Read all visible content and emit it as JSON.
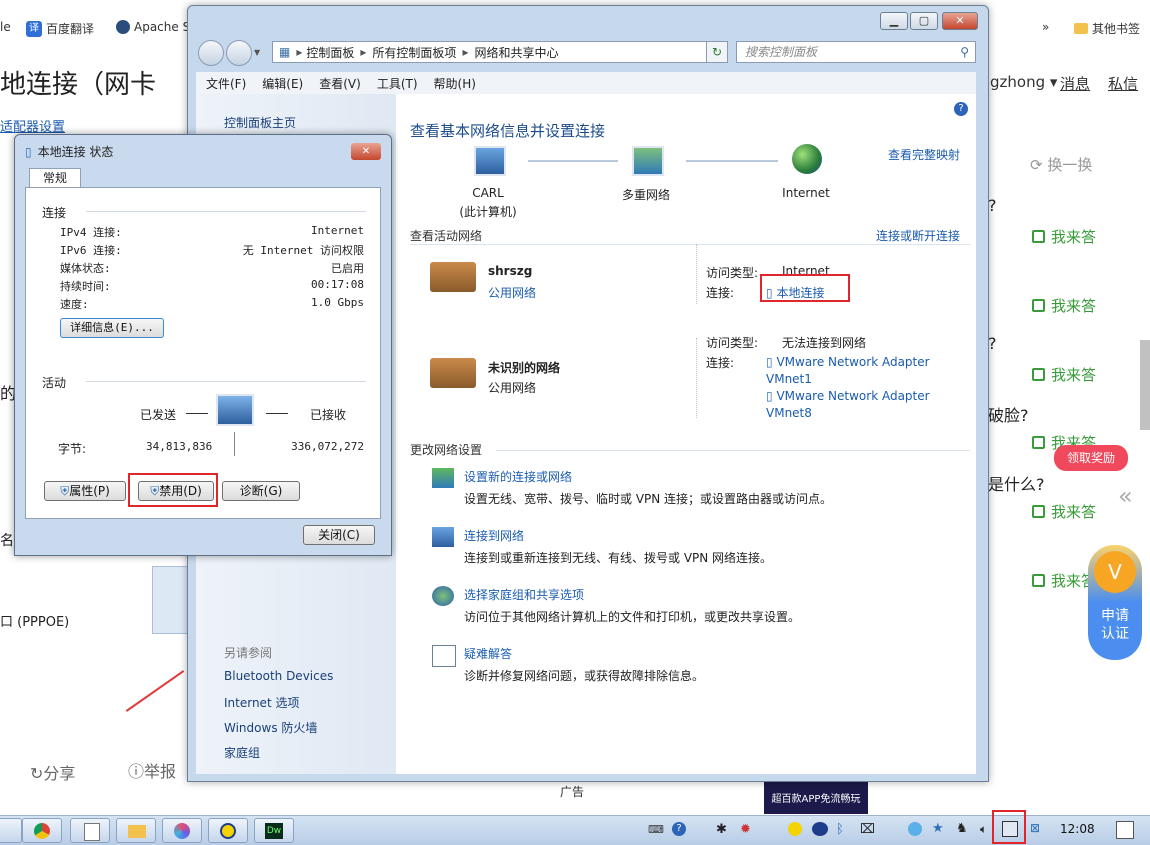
{
  "browser": {
    "bookmarks": [
      "le",
      "百度翻译",
      "Apache S",
      "其他书签"
    ],
    "overflow": "»",
    "page_title": "地连接（网卡",
    "partial_link": "适配器设置",
    "user_menu": "gzhong",
    "nav": [
      "消息",
      "私信"
    ],
    "refresh": "换一换",
    "questions": [
      "?",
      "?",
      "破脸?",
      "是什么?"
    ],
    "answer_label": "我来答",
    "reward_badge": "领取奖励",
    "apply_cert": "申请\n认证",
    "share": "分享",
    "report": "举报",
    "pppoe": "口 (PPPOE)",
    "frag_de": "的",
    "frag_ming": "名",
    "ad_text": "超百款APP免流畅玩",
    "ad_label": "广告"
  },
  "window": {
    "breadcrumb": [
      "控制面板",
      "所有控制面板项",
      "网络和共享中心"
    ],
    "search_placeholder": "搜索控制面板",
    "menu": [
      "文件(F)",
      "编辑(E)",
      "查看(V)",
      "工具(T)",
      "帮助(H)"
    ],
    "left": {
      "home": "控制面板主页",
      "see_also": "另请参阅",
      "links": [
        "Bluetooth Devices",
        "Internet 选项",
        "Windows 防火墙",
        "家庭组"
      ]
    },
    "heading": "查看基本网络信息并设置连接",
    "full_map": "查看完整映射",
    "map": {
      "pc": "CARL",
      "pc_sub": "(此计算机)",
      "multi": "多重网络",
      "internet": "Internet"
    },
    "active_title": "查看活动网络",
    "connect_link": "连接或断开连接",
    "networks": [
      {
        "name": "shrszg",
        "type": "公用网络",
        "access_label": "访问类型:",
        "access": "Internet",
        "conn_label": "连接:",
        "conns": [
          "本地连接"
        ]
      },
      {
        "name": "未识别的网络",
        "type": "公用网络",
        "access_label": "访问类型:",
        "access": "无法连接到网络",
        "conn_label": "连接:",
        "conns": [
          "VMware Network Adapter VMnet1",
          "VMware Network Adapter VMnet8"
        ]
      }
    ],
    "change_title": "更改网络设置",
    "tasks": [
      {
        "title": "设置新的连接或网络",
        "desc": "设置无线、宽带、拨号、临时或 VPN 连接；或设置路由器或访问点。"
      },
      {
        "title": "连接到网络",
        "desc": "连接到或重新连接到无线、有线、拨号或 VPN 网络连接。"
      },
      {
        "title": "选择家庭组和共享选项",
        "desc": "访问位于其他网络计算机上的文件和打印机，或更改共享设置。"
      },
      {
        "title": "疑难解答",
        "desc": "诊断并修复网络问题，或获得故障排除信息。"
      }
    ]
  },
  "dialog": {
    "title": "本地连接 状态",
    "tab": "常规",
    "conn_section": "连接",
    "rows": [
      {
        "label": "IPv4 连接:",
        "value": "Internet"
      },
      {
        "label": "IPv6 连接:",
        "value": "无 Internet 访问权限"
      },
      {
        "label": "媒体状态:",
        "value": "已启用"
      },
      {
        "label": "持续时间:",
        "value": "00:17:08"
      },
      {
        "label": "速度:",
        "value": "1.0 Gbps"
      }
    ],
    "details_btn": "详细信息(E)...",
    "activity": "活动",
    "sent": "已发送",
    "recv": "已接收",
    "bytes_label": "字节:",
    "bytes_sent": "34,813,836",
    "bytes_recv": "336,072,272",
    "props_btn": "属性(P)",
    "disable_btn": "禁用(D)",
    "diag_btn": "诊断(G)",
    "close_btn": "关闭(C)"
  },
  "taskbar": {
    "time": "12:08"
  }
}
